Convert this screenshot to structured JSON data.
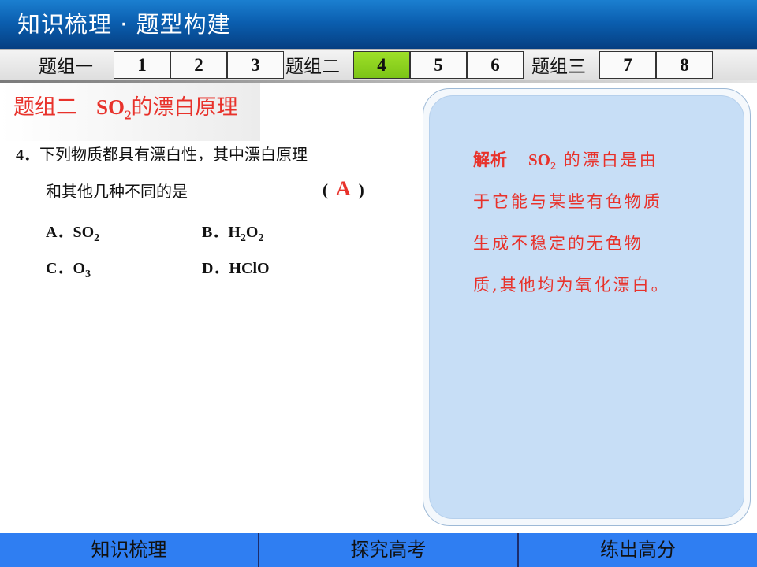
{
  "header": {
    "title": "知识梳理 · 题型构建"
  },
  "tabbar": {
    "groups": [
      {
        "label": "题组一",
        "numbers": [
          "1",
          "2",
          "3"
        ]
      },
      {
        "label": "题组二",
        "numbers": [
          "4",
          "5",
          "6"
        ]
      },
      {
        "label": "题组三",
        "numbers": [
          "7",
          "8"
        ]
      }
    ],
    "active_number": "4"
  },
  "section": {
    "group": "题组二",
    "formula": "SO",
    "formula_sub": "2",
    "title_rest": "的漂白原理"
  },
  "question": {
    "number": "4．",
    "line1": "下列物质都具有漂白性，其中漂白原理",
    "line2": "和其他几种不同的是",
    "paren_open": "(",
    "answer": "A",
    "paren_close": ")",
    "options": {
      "a_label": "A．",
      "a_main": "SO",
      "a_sub": "2",
      "b_label": "B．",
      "b_h": "H",
      "b_h_sub": "2",
      "b_o": "O",
      "b_o_sub": "2",
      "c_label": "C．",
      "c_main": "O",
      "c_sub": "3",
      "d_label": "D．",
      "d_main": "HClO"
    }
  },
  "explanation": {
    "label": "解析",
    "formula": "SO",
    "formula_sub": "2",
    "line1_rest": " 的漂白是由",
    "line2": "于它能与某些有色物质",
    "line3": "生成不稳定的无色物",
    "line4": "质,其他均为氧化漂白。"
  },
  "bottom_nav": {
    "item1": "知识梳理",
    "item2": "探究高考",
    "item3": "练出高分"
  },
  "colors": {
    "accent_red": "#e8322b",
    "active_tab": "#8fd41f",
    "header_blue": "#0b5fb0",
    "panel_blue": "#c7def6"
  }
}
